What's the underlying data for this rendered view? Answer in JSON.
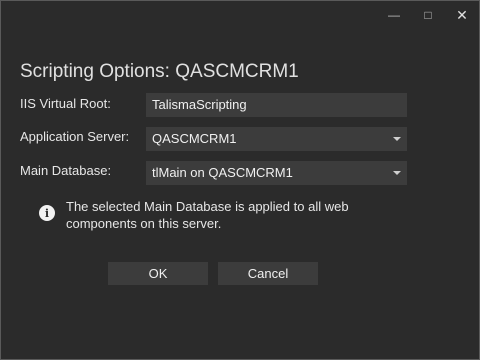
{
  "window": {
    "minimize_icon": "minimize-icon",
    "maximize_icon": "maximize-icon",
    "close_icon": "close-icon"
  },
  "dialog": {
    "title": "Scripting Options: QASCMCRM1",
    "fields": {
      "iis_virtual_root": {
        "label": "IIS Virtual Root:",
        "value": "TalismaScripting"
      },
      "application_server": {
        "label": "Application Server:",
        "value": "QASCMCRM1"
      },
      "main_database": {
        "label": "Main Database:",
        "value": "tlMain on QASCMCRM1"
      }
    },
    "info": {
      "icon": "info-icon",
      "text": "The selected Main Database is applied to all web components on this server."
    },
    "buttons": {
      "ok": "OK",
      "cancel": "Cancel"
    }
  },
  "colors": {
    "background": "#2b2b2b",
    "field_background": "#3c3c3c",
    "text": "#e6e6e6",
    "border": "#5a5a5a"
  }
}
